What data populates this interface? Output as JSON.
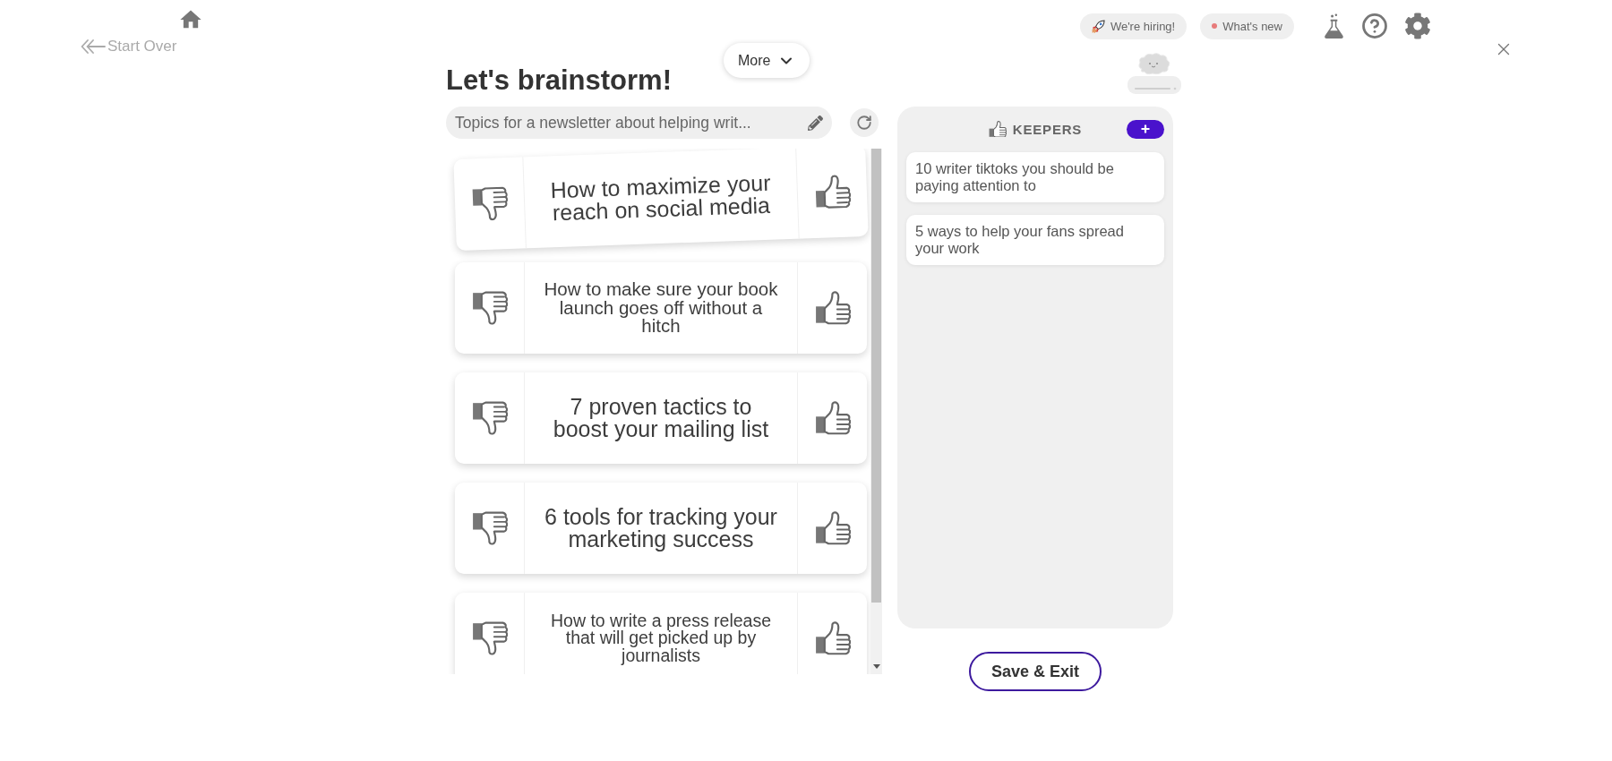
{
  "nav": {
    "start_over": "Start Over"
  },
  "header_links": [
    {
      "kind": "hiring",
      "label": "We're hiring!"
    },
    {
      "kind": "news",
      "label": "What's new"
    }
  ],
  "more_button": {
    "label": "More"
  },
  "title": "Let's brainstorm!",
  "prompt": {
    "value": "Topics for a newsletter about helping writ..."
  },
  "ideas": [
    {
      "text": "How to maximize your reach on social media",
      "tilted": true
    },
    {
      "text": "How to make sure your book launch goes off without a hitch",
      "tilted": false
    },
    {
      "text": "7 proven tactics to boost your mailing list",
      "tilted": false
    },
    {
      "text": "6 tools for tracking your marketing success",
      "tilted": false
    },
    {
      "text": "How to write a press release that will get picked up by journalists",
      "tilted": false
    }
  ],
  "keepers": {
    "title": "KEEPERS",
    "items": [
      "10 writer tiktoks you should be paying attention to",
      "5 ways to help your fans spread your work"
    ]
  },
  "save_button": {
    "label": "Save & Exit"
  }
}
